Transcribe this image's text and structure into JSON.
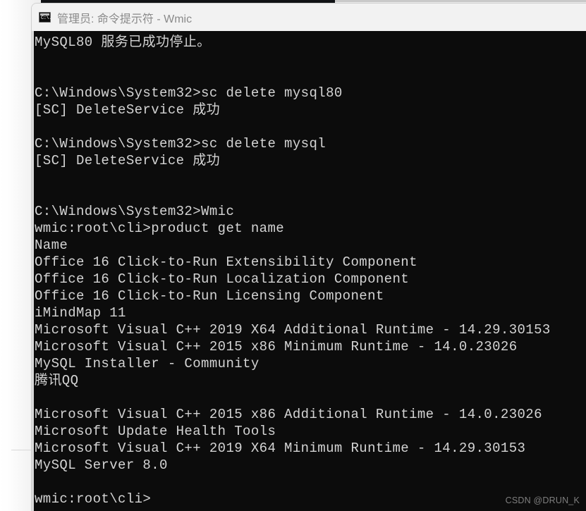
{
  "window": {
    "title": "管理员: 命令提示符 - Wmic",
    "icon_name": "console-app-icon",
    "icon_glyph": "C:\\."
  },
  "terminal": {
    "colors": {
      "background": "#0c0c0c",
      "foreground": "#d4d4d4",
      "titlebar_background": "#f2f2f2",
      "titlebar_text": "#8a8a8a"
    },
    "lines": [
      "MySQL80 服务已成功停止。",
      "",
      "",
      "C:\\Windows\\System32>sc delete mysql80",
      "[SC] DeleteService 成功",
      "",
      "C:\\Windows\\System32>sc delete mysql",
      "[SC] DeleteService 成功",
      "",
      "",
      "C:\\Windows\\System32>Wmic",
      "wmic:root\\cli>product get name",
      "Name",
      "Office 16 Click-to-Run Extensibility Component",
      "Office 16 Click-to-Run Localization Component",
      "Office 16 Click-to-Run Licensing Component",
      "iMindMap 11",
      "Microsoft Visual C++ 2019 X64 Additional Runtime - 14.29.30153",
      "Microsoft Visual C++ 2015 x86 Minimum Runtime - 14.0.23026",
      "MySQL Installer - Community",
      "腾讯QQ",
      "",
      "Microsoft Visual C++ 2015 x86 Additional Runtime - 14.0.23026",
      "Microsoft Update Health Tools",
      "Microsoft Visual C++ 2019 X64 Minimum Runtime - 14.29.30153",
      "MySQL Server 8.0",
      "",
      "wmic:root\\cli>"
    ]
  },
  "watermark": {
    "text": "CSDN @DRUN_K"
  }
}
